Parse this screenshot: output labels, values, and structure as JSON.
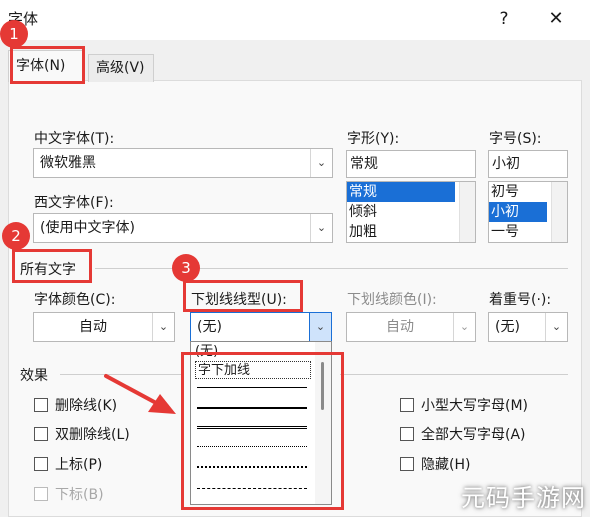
{
  "window": {
    "title": "字体",
    "help_label": "?",
    "close_label": "✕"
  },
  "tabs": [
    {
      "label": "字体(N)"
    },
    {
      "label": "高级(V)"
    }
  ],
  "annotations": {
    "badge1": "1",
    "badge2": "2",
    "badge3": "3",
    "arrow_color": "#e53935",
    "highlight_color": "#e53935"
  },
  "chinese_font": {
    "label": "中文字体(T):",
    "value": "微软雅黑"
  },
  "western_font": {
    "label": "西文字体(F):",
    "value": "(使用中文字体)"
  },
  "style": {
    "label": "字形(Y):",
    "value": "常规",
    "options": [
      "常规",
      "倾斜",
      "加粗"
    ],
    "selected": "常规"
  },
  "size": {
    "label": "字号(S):",
    "value": "小初",
    "options": [
      "初号",
      "小初",
      "一号"
    ],
    "selected": "小初"
  },
  "all_text": {
    "title": "所有文字",
    "font_color": {
      "label": "字体颜色(C):",
      "value": "自动"
    },
    "underline_type": {
      "label": "下划线线型(U):",
      "value": "(无)"
    },
    "underline_color": {
      "label": "下划线颜色(I):",
      "value": "自动"
    },
    "emphasis": {
      "label": "着重号(·):",
      "value": "(无)"
    }
  },
  "underline_dropdown": {
    "items": [
      "(无)",
      "字下加线"
    ],
    "selected": "字下加线"
  },
  "effects": {
    "title": "效果",
    "strikethrough": "删除线(K)",
    "double_strikethrough": "双删除线(L)",
    "superscript": "上标(P)",
    "subscript": "下标(B)",
    "small_caps": "小型大写字母(M)",
    "all_caps": "全部大写字母(A)",
    "hidden": "隐藏(H)"
  },
  "watermark": "元码手游网"
}
